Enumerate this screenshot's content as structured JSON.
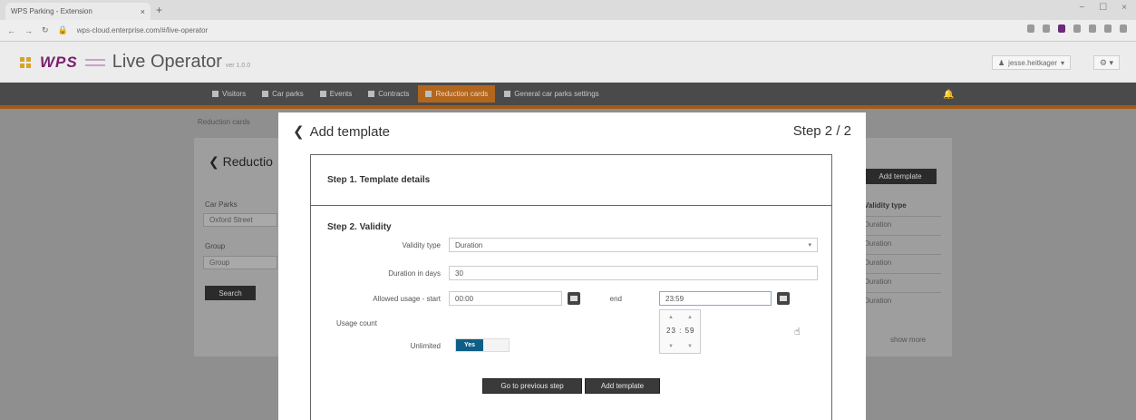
{
  "browser": {
    "tab_title": "WPS Parking - Extension",
    "tab_close": "×",
    "new_tab": "+",
    "url": "wps-cloud.enterprise.com/#/live-operator",
    "window_controls": [
      "−",
      "☐",
      "×"
    ]
  },
  "app": {
    "brand": "WPS",
    "title": "Live Operator",
    "version": "ver 1.0.0",
    "user": "jesse.heitkager",
    "settings": "⚙ ▾"
  },
  "nav": {
    "items": [
      {
        "label": "Visitors",
        "active": false
      },
      {
        "label": "Car parks",
        "active": false
      },
      {
        "label": "Events",
        "active": false
      },
      {
        "label": "Contracts",
        "active": false
      },
      {
        "label": "Reduction cards",
        "active": true
      },
      {
        "label": "General car parks settings",
        "active": false
      }
    ],
    "bell": "🔔"
  },
  "background": {
    "breadcrumb": "Reduction cards",
    "back_title": "Reductio",
    "car_parks_label": "Car Parks",
    "car_parks_value": "Oxford Street",
    "group_label": "Group",
    "group_placeholder": "Group",
    "search_button": "Search",
    "add_template_button": "Add template",
    "column_header": "Validity type",
    "rows": [
      "Duration",
      "Duration",
      "Duration",
      "Duration",
      "Duration"
    ],
    "show_more": "show more"
  },
  "modal": {
    "back_label": "Add template",
    "step_indicator": "Step 2 / 2",
    "step1_title": "Step 1. Template details",
    "step2_title": "Step 2. Validity",
    "validity_type_label": "Validity type",
    "validity_type_value": "Duration",
    "duration_label": "Duration in days",
    "duration_value": "30",
    "usage_start_label": "Allowed usage - start",
    "usage_start_value": "00:00",
    "end_label": "end",
    "end_value": "23:59",
    "time_hours": "23",
    "time_minutes": "59",
    "usage_count_label": "Usage count",
    "unlimited_label": "Unlimited",
    "toggle_value": "Yes",
    "prev_button": "Go to previous step",
    "add_button": "Add template"
  }
}
